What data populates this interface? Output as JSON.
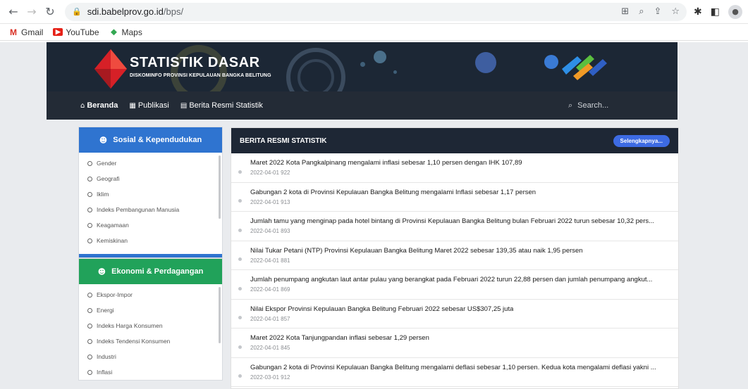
{
  "browser": {
    "url_domain": "sdi.babelprov.go.id",
    "url_path": "/bps/",
    "bookmarks": [
      {
        "label": "Gmail"
      },
      {
        "label": "YouTube"
      },
      {
        "label": "Maps"
      }
    ]
  },
  "header": {
    "title": "STATISTIK DASAR",
    "subtitle": "DISKOMINFO PROVINSI KEPULAUAN BANGKA BELITUNG"
  },
  "nav": {
    "items": [
      {
        "label": "Beranda",
        "icon": "home-icon"
      },
      {
        "label": "Publikasi",
        "icon": "grid-icon"
      },
      {
        "label": "Berita Resmi Statistik",
        "icon": "newspaper-icon"
      }
    ],
    "search_placeholder": "Search..."
  },
  "sidebar": {
    "panels": [
      {
        "title": "Sosial & Kependudukan",
        "color": "#2f74d0",
        "items": [
          "Gender",
          "Geografi",
          "Iklim",
          "Indeks Pembangunan Manusia",
          "Keagamaan",
          "Kemiskinan"
        ]
      },
      {
        "title": "Ekonomi & Perdagangan",
        "color": "#21a25a",
        "items": [
          "Ekspor-Impor",
          "Energi",
          "Indeks Harga Konsumen",
          "Indeks Tendensi Konsumen",
          "Industri",
          "Inflasi"
        ]
      }
    ]
  },
  "news": {
    "title": "BERITA RESMI STATISTIK",
    "more_label": "Selengkapnya...",
    "items": [
      {
        "title": "Maret 2022 Kota Pangkalpinang mengalami inflasi sebesar 1,10 persen dengan IHK 107,89",
        "meta": "2022-04-01 922"
      },
      {
        "title": "Gabungan 2 kota di Provinsi Kepulauan Bangka Belitung mengalami Inflasi sebesar 1,17 persen",
        "meta": "2022-04-01 913"
      },
      {
        "title": "Jumlah tamu yang menginap pada hotel bintang di Provinsi Kepulauan Bangka Belitung bulan Februari 2022 turun sebesar 10,32 pers...",
        "meta": "2022-04-01 893"
      },
      {
        "title": "Nilai Tukar Petani (NTP) Provinsi Kepulauan Bangka Belitung Maret 2022 sebesar 139,35 atau naik 1,95 persen",
        "meta": "2022-04-01 881"
      },
      {
        "title": "Jumlah penumpang angkutan laut antar pulau yang berangkat pada Februari 2022 turun 22,88 persen dan jumlah penumpang angkut...",
        "meta": "2022-04-01 869"
      },
      {
        "title": "Nilai Ekspor Provinsi Kepulauan Bangka Belitung Februari 2022 sebesar US$307,25 juta",
        "meta": "2022-04-01 857"
      },
      {
        "title": "Maret 2022 Kota Tanjungpandan inflasi sebesar 1,29 persen",
        "meta": "2022-04-01 845"
      },
      {
        "title": "Gabungan 2 kota di Provinsi Kepulauan Bangka Belitung mengalami deflasi sebesar 1,10 persen. Kedua kota mengalami deflasi yakni ...",
        "meta": "2022-03-01 912"
      }
    ]
  }
}
